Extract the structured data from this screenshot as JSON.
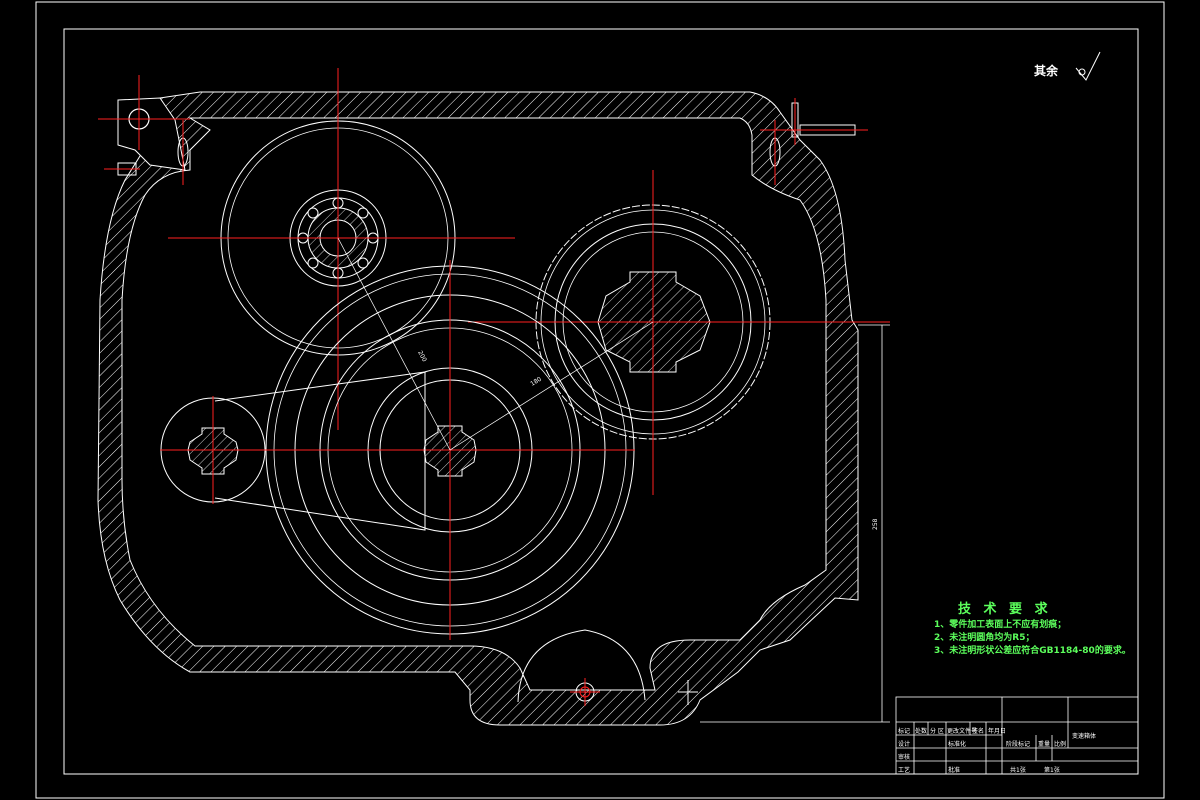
{
  "drawing": {
    "roughness_label": "其余",
    "dimensions": {
      "bore_spacing_a": "200",
      "bore_spacing_b": "180",
      "overall_height": "258"
    },
    "technical_requirements": {
      "title": "技 术 要 求",
      "items": [
        "1、零件加工表面上不应有划痕；",
        "2、未注明圆角均为R5；",
        "3、未注明形状公差应符合GB1184-80的要求。"
      ]
    },
    "title_block": {
      "row1": [
        "标记",
        "处数",
        "分  区",
        "更改文件号",
        "签名",
        "年月日"
      ],
      "row2": [
        "设计",
        "标准化"
      ],
      "row3": [
        "审核"
      ],
      "row4": [
        "工艺",
        "批准"
      ],
      "stage_label": "阶段标记",
      "weight_label": "重量",
      "scale_label": "比例",
      "sheets_label": "共1张",
      "sheet_label": "第1张",
      "part_name": "变速箱体"
    }
  },
  "colors": {
    "background": "#000000",
    "outline": "#ffffff",
    "centerline": "#ff2020",
    "notes": "#5cff5c"
  }
}
